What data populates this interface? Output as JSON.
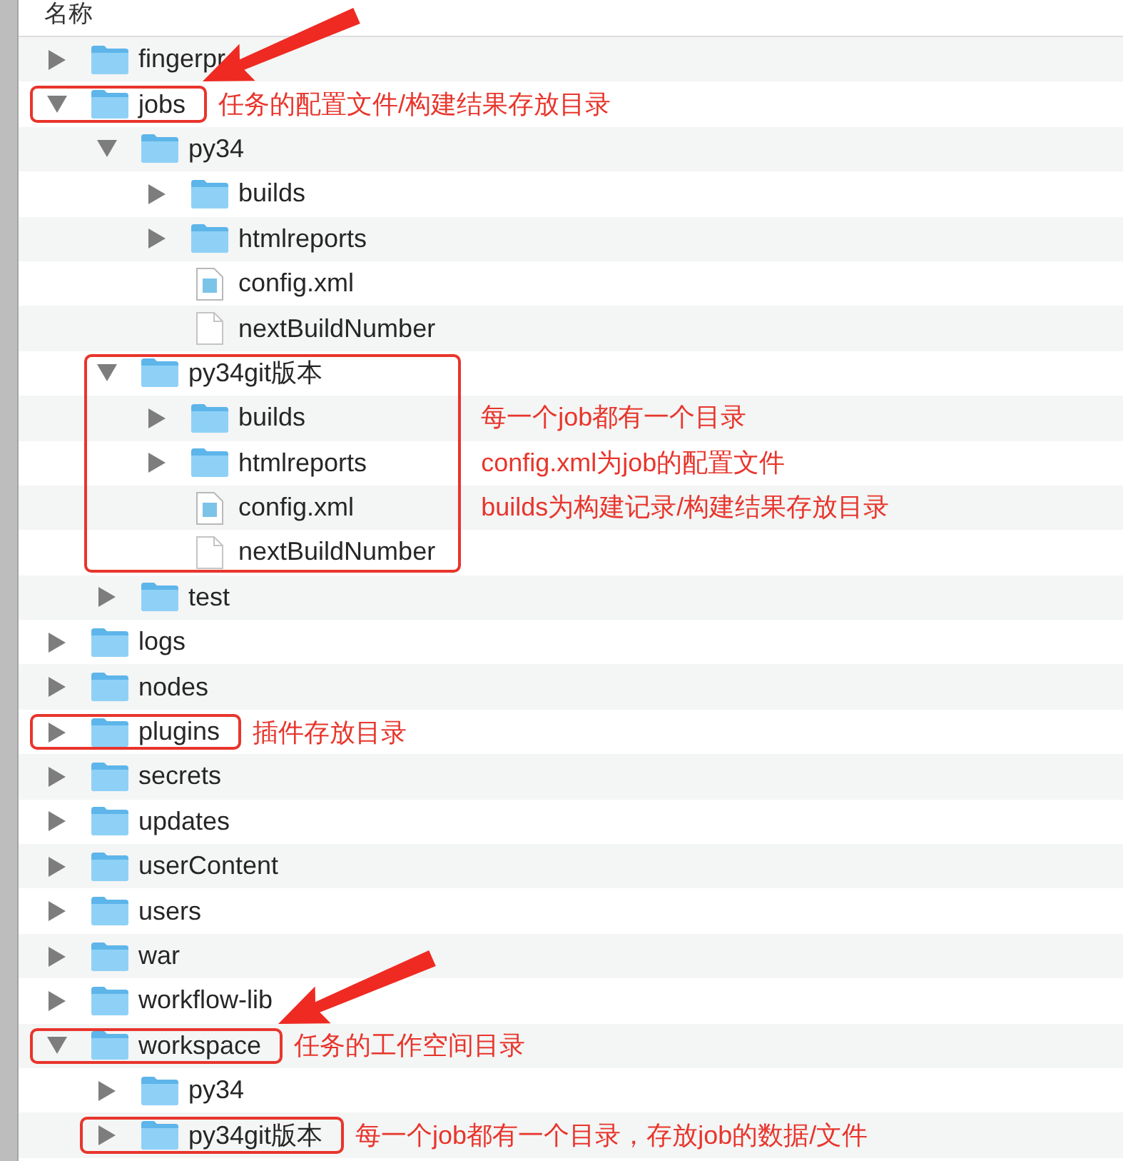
{
  "header": {
    "column": "名称"
  },
  "items": [
    {
      "name": "fingerpr",
      "kind": "folder",
      "expanded": false
    },
    {
      "name": "jobs",
      "kind": "folder",
      "expanded": true,
      "annotation": {
        "kind": "row",
        "arrow": true,
        "note_lines": [
          "任务的配置文件/构建结果存放目录"
        ]
      },
      "children": [
        {
          "name": "py34",
          "kind": "folder",
          "expanded": true,
          "children": [
            {
              "name": "builds",
              "kind": "folder",
              "expanded": false
            },
            {
              "name": "htmlreports",
              "kind": "folder",
              "expanded": false
            },
            {
              "name": "config.xml",
              "kind": "xml"
            },
            {
              "name": "nextBuildNumber",
              "kind": "file"
            }
          ]
        },
        {
          "name": "py34git版本",
          "kind": "folder",
          "expanded": true,
          "annotation": {
            "kind": "group",
            "arrow": false,
            "note_lines": [
              "每一个job都有一个目录",
              "config.xml为job的配置文件",
              "builds为构建记录/构建结果存放目录"
            ]
          },
          "children": [
            {
              "name": "builds",
              "kind": "folder",
              "expanded": false
            },
            {
              "name": "htmlreports",
              "kind": "folder",
              "expanded": false
            },
            {
              "name": "config.xml",
              "kind": "xml"
            },
            {
              "name": "nextBuildNumber",
              "kind": "file"
            }
          ]
        },
        {
          "name": "test",
          "kind": "folder",
          "expanded": false
        }
      ]
    },
    {
      "name": "logs",
      "kind": "folder",
      "expanded": false
    },
    {
      "name": "nodes",
      "kind": "folder",
      "expanded": false
    },
    {
      "name": "plugins",
      "kind": "folder",
      "expanded": false,
      "annotation": {
        "kind": "row",
        "arrow": false,
        "note_lines": [
          "插件存放目录"
        ]
      }
    },
    {
      "name": "secrets",
      "kind": "folder",
      "expanded": false
    },
    {
      "name": "updates",
      "kind": "folder",
      "expanded": false
    },
    {
      "name": "userContent",
      "kind": "folder",
      "expanded": false
    },
    {
      "name": "users",
      "kind": "folder",
      "expanded": false
    },
    {
      "name": "war",
      "kind": "folder",
      "expanded": false
    },
    {
      "name": "workflow-lib",
      "kind": "folder",
      "expanded": false
    },
    {
      "name": "workspace",
      "kind": "folder",
      "expanded": true,
      "annotation": {
        "kind": "row",
        "arrow": true,
        "note_lines": [
          "任务的工作空间目录"
        ]
      },
      "children": [
        {
          "name": "py34",
          "kind": "folder",
          "expanded": false
        },
        {
          "name": "py34git版本",
          "kind": "folder",
          "expanded": false,
          "annotation": {
            "kind": "row",
            "arrow": false,
            "note_lines": [
              "每一个job都有一个目录，存放job的数据/文件"
            ]
          }
        }
      ]
    }
  ]
}
